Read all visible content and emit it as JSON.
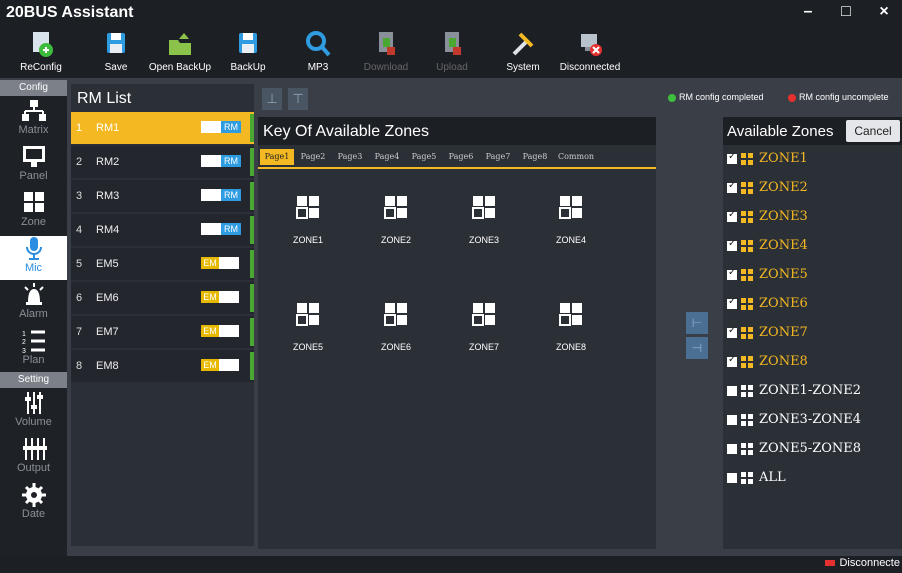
{
  "window": {
    "title": "20BUS Assistant",
    "minimize": "–",
    "maximize": "□",
    "close": "×"
  },
  "toolbar": {
    "items": [
      {
        "label": "ReConfig",
        "icon": "reconfig-icon"
      },
      {
        "label": "Save",
        "icon": "save-icon"
      },
      {
        "label": "Open BackUp",
        "icon": "folder-icon"
      },
      {
        "label": "BackUp",
        "icon": "backup-icon"
      },
      {
        "label": "MP3",
        "icon": "search-icon"
      },
      {
        "label": "Download",
        "icon": "download-icon",
        "disabled": true
      },
      {
        "label": "Upload",
        "icon": "upload-icon",
        "disabled": true
      },
      {
        "label": "System",
        "icon": "tools-icon"
      },
      {
        "label": "Disconnected",
        "icon": "disconnected-icon"
      }
    ]
  },
  "nav": {
    "config_header": "Config",
    "setting_header": "Setting",
    "items": [
      {
        "label": "Matrix",
        "icon": "matrix-icon"
      },
      {
        "label": "Panel",
        "icon": "panel-icon"
      },
      {
        "label": "Zone",
        "icon": "zone-icon"
      },
      {
        "label": "Mic",
        "icon": "mic-icon",
        "active": true
      },
      {
        "label": "Alarm",
        "icon": "alarm-icon"
      },
      {
        "label": "Plan",
        "icon": "plan-icon"
      },
      {
        "label": "Volume",
        "icon": "volume-icon"
      },
      {
        "label": "Output",
        "icon": "output-icon"
      },
      {
        "label": "Date",
        "icon": "gear-icon"
      }
    ]
  },
  "rm_list": {
    "title": "RM List",
    "rows": [
      {
        "num": "1",
        "name": "RM1",
        "tag": "RM",
        "selected": true
      },
      {
        "num": "2",
        "name": "RM2",
        "tag": "RM"
      },
      {
        "num": "3",
        "name": "RM3",
        "tag": "RM"
      },
      {
        "num": "4",
        "name": "RM4",
        "tag": "RM"
      },
      {
        "num": "5",
        "name": "EM5",
        "tag": "EM"
      },
      {
        "num": "6",
        "name": "EM6",
        "tag": "EM"
      },
      {
        "num": "7",
        "name": "EM7",
        "tag": "EM"
      },
      {
        "num": "8",
        "name": "EM8",
        "tag": "EM"
      }
    ]
  },
  "controls": {
    "up_icon": "⊥",
    "down_icon": "⊤"
  },
  "legend": {
    "completed": "RM config completed",
    "uncompleted": "RM config uncomplete",
    "completed_color": "#3fbf3f",
    "uncompleted_color": "#e53030"
  },
  "key_panel": {
    "title": "Key Of Available Zones",
    "tabs": [
      "Page1",
      "Page2",
      "Page3",
      "Page4",
      "Page5",
      "Page6",
      "Page7",
      "Page8",
      "Common"
    ],
    "active_tab": "Page1",
    "zones": [
      "ZONE1",
      "ZONE2",
      "ZONE3",
      "ZONE4",
      "ZONE5",
      "ZONE6",
      "ZONE7",
      "ZONE8"
    ]
  },
  "move_buttons": {
    "add": "⊢",
    "remove": "⊣"
  },
  "available": {
    "title": "Available Zones",
    "cancel_label": "Cancel",
    "items": [
      {
        "label": "ZONE1",
        "checked": true,
        "color": "#f4b822"
      },
      {
        "label": "ZONE2",
        "checked": true,
        "color": "#f4b822"
      },
      {
        "label": "ZONE3",
        "checked": true,
        "color": "#f4b822"
      },
      {
        "label": "ZONE4",
        "checked": true,
        "color": "#f4b822"
      },
      {
        "label": "ZONE5",
        "checked": true,
        "color": "#f4b822"
      },
      {
        "label": "ZONE6",
        "checked": true,
        "color": "#f4b822"
      },
      {
        "label": "ZONE7",
        "checked": true,
        "color": "#f4b822"
      },
      {
        "label": "ZONE8",
        "checked": true,
        "color": "#f4b822"
      },
      {
        "label": "ZONE1-ZONE2",
        "checked": false,
        "color": "#ffffff"
      },
      {
        "label": "ZONE3-ZONE4",
        "checked": false,
        "color": "#ffffff"
      },
      {
        "label": "ZONE5-ZONE8",
        "checked": false,
        "color": "#ffffff"
      },
      {
        "label": "ALL",
        "checked": false,
        "color": "#ffffff"
      }
    ]
  },
  "status": {
    "text": "Disconnecte"
  }
}
